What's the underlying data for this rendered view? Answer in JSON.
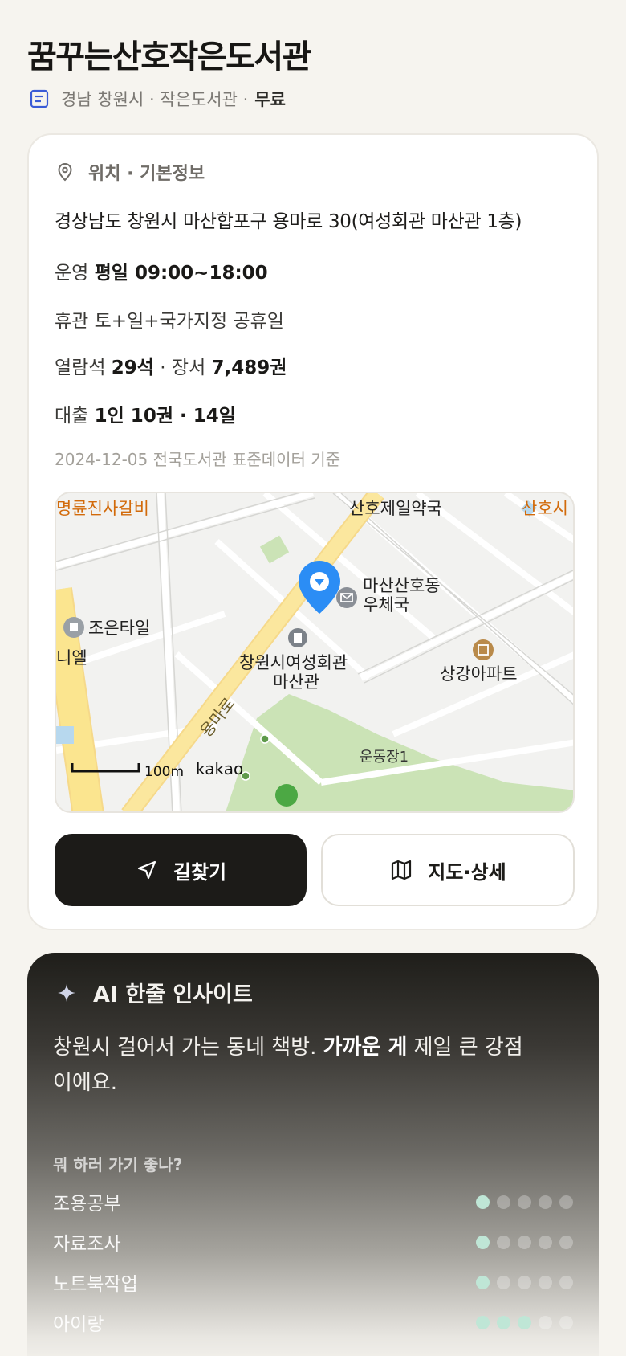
{
  "page": {
    "title": "꿈꾸는산호작은도서관",
    "subtitle": "경남 창원시 · 작은도서관 ·",
    "fee": "무료"
  },
  "info": {
    "section_title": "위치 · 기본정보",
    "address": "경상남도 창원시 마산합포구 용마로 30(여성회관 마산관 1층)",
    "hours_label": "운영",
    "hours_value": "평일 09:00~18:00",
    "closed_label": "휴관",
    "closed_value": "토+일+국가지정 공휴일",
    "seats_label": "열람석",
    "seats_value": "29석",
    "sep": "·",
    "books_label": "장서",
    "books_value": "7,489권",
    "loan_label": "대출",
    "loan_value": "1인 10권 · 14일",
    "basis": "2024-12-05 전국도서관 표준데이터 기준"
  },
  "map": {
    "labels": {
      "galbi": "명륜진사갈비",
      "pharmacy": "산호제일약국",
      "sanho": "산호시",
      "post1": "마산산호동",
      "post2": "우체국",
      "tile": "조은타일",
      "niel": "니엘",
      "center1": "창원시여성회관",
      "center2": "마산관",
      "apt": "상강아파트",
      "road": "용마로",
      "field": "운동장1",
      "scale": "100m",
      "brand": "kakao"
    }
  },
  "actions": {
    "directions": "길찾기",
    "map_detail": "지도·상세"
  },
  "ai": {
    "title": "AI 한줄 인사이트",
    "text_a": "창원시 걸어서 가는 동네 책방. ",
    "text_b": "가까운 게",
    "text_c": " 제일 큰 강점이에요.",
    "question": "뭐 하러 가기 좋나?",
    "activities": [
      {
        "label": "조용공부",
        "score": 1
      },
      {
        "label": "자료조사",
        "score": 1
      },
      {
        "label": "노트북작업",
        "score": 1
      },
      {
        "label": "아이랑",
        "score": 3
      }
    ]
  },
  "colors": {
    "accent_dark": "#1c1b18",
    "map_pin": "#2b8df5",
    "dot_active": "#bfe6d6",
    "map_poi_orange": "#d26a0a"
  }
}
